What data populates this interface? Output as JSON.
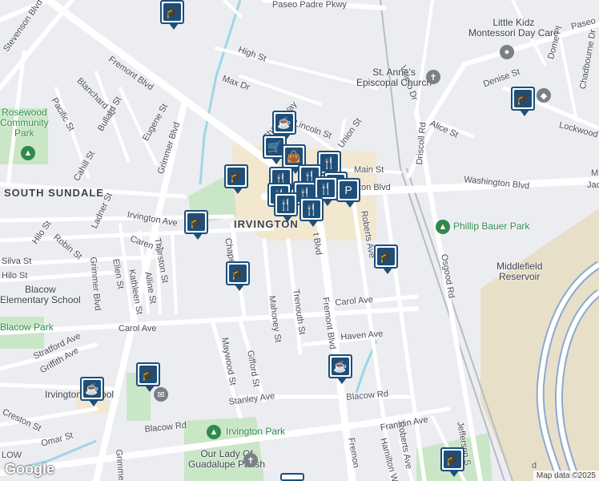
{
  "labels": {
    "stevenson": "Stevenson Blvd",
    "fremont_nw": "Fremont Blvd",
    "high": "High St",
    "max": "Max Dr",
    "blanchard": "Blanchard St",
    "pacific": "Pacific St",
    "bullard": "Bullard St",
    "eugene": "Eugene St",
    "grimmer_n": "Grimmer Blvd",
    "cahill": "Cahill St",
    "ladner": "Ladner St",
    "chapel": "Chapel Way",
    "lincoln": "Lincoln St",
    "union": "Union St",
    "main": "Main St",
    "valero": "Valero Dr",
    "paseo_padre": "Paseo Padre Pkwy",
    "paseo_e": "Paseo",
    "dome": "Dome Pl",
    "chadbourne": "Chadbourne Dr",
    "denise": "Denise St",
    "alice": "Alice St",
    "lockwood": "Lockwood",
    "driscoll": "Driscoll Rd",
    "washington_w": "Washington Blvd",
    "washington_e": "Washington Blvd",
    "irvington_ave": "Irvington Ave",
    "caren": "Caren St",
    "thurston": "Thurston St",
    "robin": "Robin St",
    "hilo": "Hilo St",
    "silva": "Silva St",
    "hilo_s": "Hilo St",
    "grimmer_s": "Grimmer Blvd",
    "ellen": "Ellen St",
    "kathleen": "Kathleen St",
    "alline": "Alline St",
    "chapel_s": "Chapel",
    "mahoney": "Mahoney St",
    "trenouth": "Trenouth St",
    "fremont_s": "Fremont Blvd",
    "fremont_c": "t Blvd",
    "roberts": "Roberts Ave",
    "osgood": "Osgood Rd",
    "carol_w": "Carol Ave",
    "carol_e": "Carol Ave",
    "stratford": "Stratford Ave",
    "griffith": "Griffith Ave",
    "haven": "Haven Ave",
    "maywood": "Maywood St",
    "gifford": "Gifford St",
    "stanley": "Stanley Ave",
    "blacow_rd_e": "Blacow Rd",
    "blacow_rd_w": "Blacow Rd",
    "franklin": "Franklin Ave",
    "creston": "Creston St",
    "omar": "Omar St",
    "grimme": "Grimme",
    "hamilton": "Hamilton W",
    "roberts_s": "Roberts Ave",
    "jefferson": "Jefferson S",
    "fremont_bot": "Fremon",
    "blvd_ton": "ton Blvd",
    "jack": "Jack",
    "m_st": "M",
    "low": "LOW",
    "d_st": "d"
  },
  "districts": {
    "south_sundale": "SOUTH SUNDALE",
    "irvington": "IRVINGTON"
  },
  "pois": {
    "little_kidz": "Little Kidz\nMontessori Day Care",
    "st_annes": "St. Anne's\nEpiscopal Church",
    "middlefield": "Middlefield\nReservoir",
    "blacow_elem": "Blacow\nElementary School",
    "irvington_school": "Irvington School",
    "our_lady": "Our Lady Of\nGuadalupe Parish"
  },
  "parks": {
    "rosewood": "Rosewood\nCommunity\nPark",
    "phillip_bauer": "Phillip Bauer Park",
    "blacow_park": "Blacow Park",
    "irvington_park": "Irvington Park"
  },
  "pins": {
    "school": "school-icon",
    "coffee": "coffee-icon",
    "restaurant": "restaurant-icon",
    "shopping": "shopping-cart-icon",
    "parking": "parking-icon",
    "bag": "shopping-bag-icon"
  },
  "attribution": {
    "brand": "Google",
    "credit": "Map data ©2025"
  },
  "colors": {
    "pin_blue": "#1d4f7a",
    "park_green": "#c9e6c6",
    "water": "#9fd6e6",
    "road": "#ffffff",
    "highway_outline": "#8ba9cf",
    "district_tan": "#f2e7cf"
  }
}
